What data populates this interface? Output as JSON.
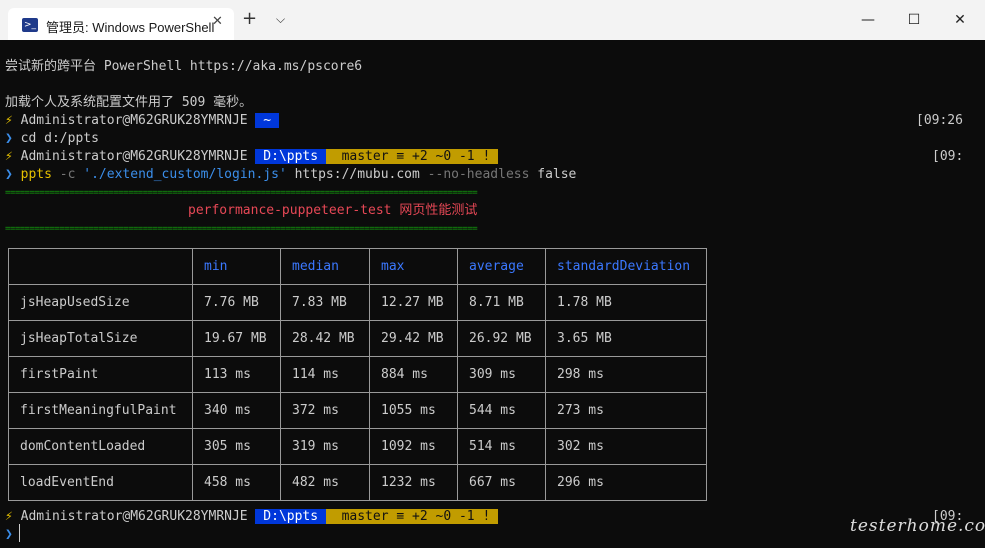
{
  "window": {
    "tab_icon": "powershell-icon",
    "tab_title": "管理员: Windows PowerShell",
    "tab_close": "✕",
    "new_tab": "+",
    "dropdown": "⌵",
    "minimize": "—",
    "maximize": "☐",
    "close": "✕"
  },
  "terminal": {
    "intro1": "尝试新的跨平台 PowerShell https://aka.ms/pscore6",
    "intro2": "加载个人及系统配置文件用了 509 毫秒。",
    "bolt": "⚡",
    "user": " Administrator@M62GRUK28YMRNJE ",
    "home_seg": " ~ ",
    "sep_glyph": "",
    "time1": "[09:26",
    "time2": "[09:",
    "time3": "[09:",
    "prompt_char": "❯",
    "cmd1": " cd d:/ppts",
    "path_seg": " D:\\ppts ",
    "git_seg": "  master ≡ +2 ~0 -1 ! ",
    "cmd2_name": " ppts",
    "cmd2_flag": " -c ",
    "cmd2_str": "'./extend_custom/login.js'",
    "cmd2_url": " https://mubu.com ",
    "cmd2_opt": "--no-headless",
    "cmd2_val": " false",
    "rule": "================================================================================================",
    "banner": "performance-puppeteer-test 网页性能测试"
  },
  "table": {
    "headers": [
      "",
      "min",
      "median",
      "max",
      "average",
      "standardDeviation"
    ],
    "rows": [
      [
        "jsHeapUsedSize",
        "7.76 MB",
        "7.83 MB",
        "12.27 MB",
        "8.71 MB",
        "1.78 MB"
      ],
      [
        "jsHeapTotalSize",
        "19.67 MB",
        "28.42 MB",
        "29.42 MB",
        "26.92 MB",
        "3.65 MB"
      ],
      [
        "firstPaint",
        "113 ms",
        "114 ms",
        "884 ms",
        "309 ms",
        "298 ms"
      ],
      [
        "firstMeaningfulPaint",
        "340 ms",
        "372 ms",
        "1055 ms",
        "544 ms",
        "273 ms"
      ],
      [
        "domContentLoaded",
        "305 ms",
        "319 ms",
        "1092 ms",
        "514 ms",
        "302 ms"
      ],
      [
        "loadEventEnd",
        "458 ms",
        "482 ms",
        "1232 ms",
        "667 ms",
        "296 ms"
      ]
    ]
  },
  "watermark": "testerhome.com"
}
